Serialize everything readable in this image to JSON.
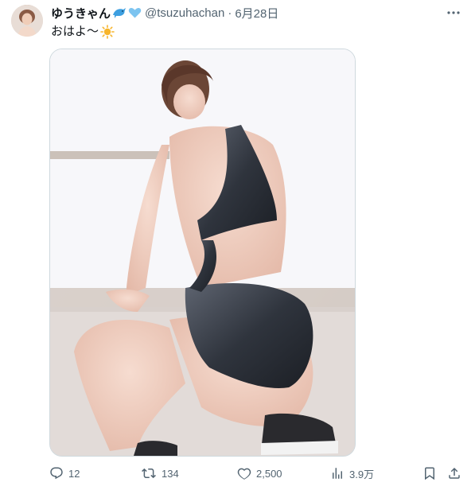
{
  "tweet": {
    "display_name": "ゆうきゃん",
    "handle": "@tsuzuhachan",
    "separator": "·",
    "date": "6月28日",
    "text": "おはよ〜",
    "icons": {
      "name_emoji_1": "dolphin-icon",
      "name_emoji_2": "blue-heart-icon",
      "text_emoji": "sun-icon",
      "more": "more-dots-icon"
    }
  },
  "actions": {
    "reply_count": "12",
    "retweet_count": "134",
    "like_count": "2,500",
    "views_count": "3.9万"
  },
  "colors": {
    "text_primary": "#0f1419",
    "text_secondary": "#536471",
    "border": "#cfd9de",
    "heart_blue": "#7cc4f0",
    "sun": "#f7b52c"
  }
}
